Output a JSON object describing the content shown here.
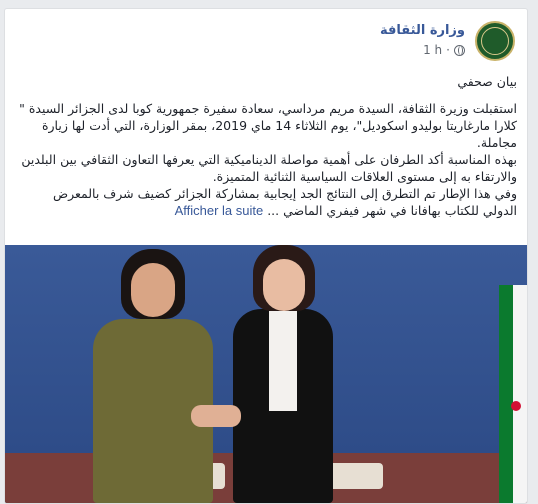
{
  "post": {
    "page_name": "وزارة الثقافة",
    "time": "1 h",
    "audience_icon": "globe-icon",
    "title": "بيان صحفي",
    "paragraphs": [
      "استقبلت وزيرة الثقافة، السيدة مريم مرداسي، سعادة سفيرة جمهورية كوبا لدى الجزائر السيدة \" كلارا مارغاريتا بوليدو اسكوديل\"، يوم الثلاثاء 14 ماي 2019، بمقر الوزارة، التي أدت لها زيارة مجاملة.",
      "بهذه المناسبة أكد الطرفان على أهمية مواصلة الديناميكية التي يعرفها التعاون الثقافي بين البلدين والارتقاء به إلى مستوى العلاقات السياسية الثنائية المتميزة.",
      "وفي هذا الإطار تم التطرق إلى النتائج الجد إيجابية بمشاركة الجزائر كضيف شرف بالمعرض الدولي للكتاب بهافانا في شهر فيفري الماضي ..."
    ],
    "see_more": "Afficher la suite",
    "colors": {
      "link": "#385898",
      "text": "#1d2129",
      "meta": "#616770"
    }
  }
}
